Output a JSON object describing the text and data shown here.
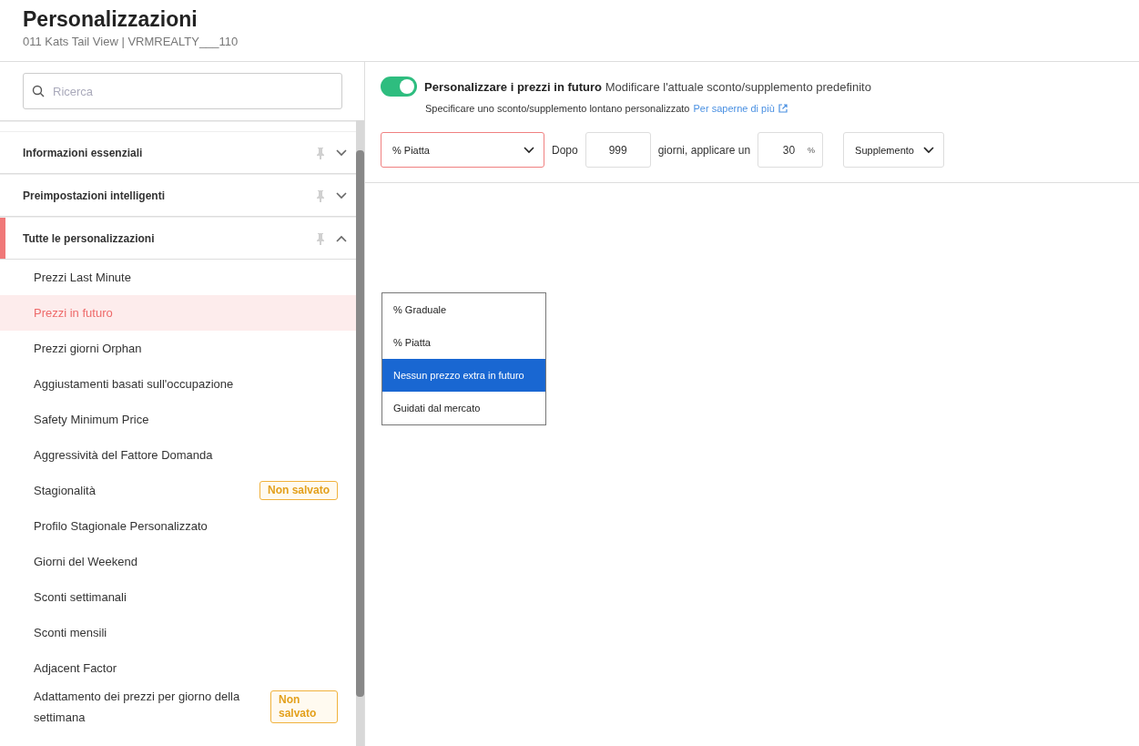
{
  "header": {
    "title": "Personalizzazioni",
    "subtitle": "011 Kats Tail View | VRMREALTY___110"
  },
  "sidebar": {
    "search": {
      "placeholder": "Ricerca"
    },
    "sections": [
      {
        "label": "Informazioni essenziali",
        "expanded": false,
        "selected": false
      },
      {
        "label": "Preimpostazioni intelligenti",
        "expanded": false,
        "selected": false
      },
      {
        "label": "Tutte le personalizzazioni",
        "expanded": true,
        "selected": true
      }
    ],
    "items": [
      {
        "label": "Prezzi Last Minute",
        "selected": false
      },
      {
        "label": "Prezzi in futuro",
        "selected": true
      },
      {
        "label": "Prezzi giorni Orphan",
        "selected": false
      },
      {
        "label": "Aggiustamenti basati sull'occupazione",
        "selected": false
      },
      {
        "label": "Safety Minimum Price",
        "selected": false
      },
      {
        "label": "Aggressività del Fattore Domanda",
        "selected": false
      },
      {
        "label": "Stagionalità",
        "selected": false,
        "badge": "Non salvato"
      },
      {
        "label": "Profilo Stagionale Personalizzato",
        "selected": false
      },
      {
        "label": "Giorni del Weekend",
        "selected": false
      },
      {
        "label": "Sconti settimanali",
        "selected": false
      },
      {
        "label": "Sconti mensili",
        "selected": false
      },
      {
        "label": "Adjacent Factor",
        "selected": false
      },
      {
        "label": "Adattamento dei prezzi per giorno della settimana",
        "selected": false,
        "badge": "Non salvato"
      }
    ]
  },
  "settings": {
    "toggle": {
      "on": true
    },
    "title": "Personalizzare i prezzi in futuro",
    "description": "Modificare l'attuale sconto/supplemento predefinito",
    "helper": "Specificare uno sconto/supplemento lontano personalizzato",
    "link": "Per saperne di più",
    "mode_select": {
      "value": "% Piatta"
    },
    "after_label": "Dopo",
    "days": {
      "value": "999"
    },
    "days_label": "giorni, applicare un",
    "percent": {
      "value": "30",
      "unit": "%"
    },
    "type_select": {
      "value": "Supplemento"
    },
    "dropdown_options": [
      {
        "label": "% Graduale",
        "selected": false
      },
      {
        "label": "% Piatta",
        "selected": false
      },
      {
        "label": "Nessun prezzo extra in futuro",
        "selected": true
      },
      {
        "label": "Guidati dal mercato",
        "selected": false
      }
    ]
  }
}
